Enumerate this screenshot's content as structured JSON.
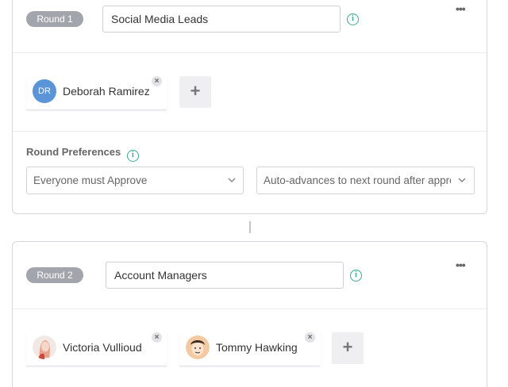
{
  "rounds": [
    {
      "badge": "Round 1",
      "name": "Social Media Leads",
      "members": [
        {
          "initials": "DR",
          "name": "Deborah Ramirez"
        }
      ],
      "preferences_label": "Round Preferences",
      "approval_select": "Everyone must Approve",
      "advance_select": "Auto-advances to next round after approval"
    },
    {
      "badge": "Round 2",
      "name": "Account Managers",
      "members": [
        {
          "name": "Victoria Vullioud"
        },
        {
          "name": "Tommy Hawking"
        }
      ]
    }
  ],
  "icons": {
    "info": "i",
    "remove": "×",
    "add": "+",
    "more": "•••"
  },
  "colors": {
    "badge": "#a3a5ad",
    "info": "#3aa890",
    "avatar_dr": "#5b95d8"
  }
}
